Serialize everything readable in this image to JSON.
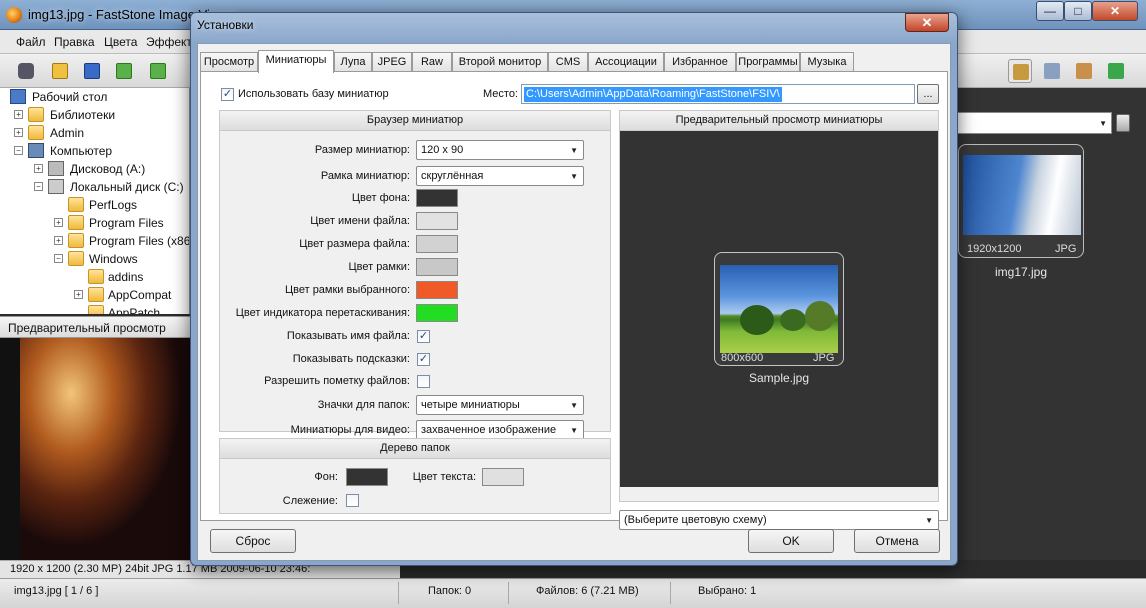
{
  "app": {
    "title": "img13.jpg  -  FastStone Image Viewer",
    "window_controls": [
      "—",
      "□",
      "✕"
    ],
    "menu": [
      "Файл",
      "Правка",
      "Цвета",
      "Эффекты"
    ]
  },
  "tree": {
    "items": [
      {
        "label": "Рабочий стол",
        "icon": "desktop-icon"
      },
      {
        "label": "Библиотеки",
        "icon": "library-icon"
      },
      {
        "label": "Admin",
        "icon": "user-folder-icon"
      },
      {
        "label": "Компьютер",
        "icon": "computer-icon"
      },
      {
        "label": "Дисковод (A:)",
        "icon": "floppy-drive-icon"
      },
      {
        "label": "Локальный диск (C:)",
        "icon": "hard-drive-icon"
      },
      {
        "label": "PerfLogs",
        "icon": "folder-icon"
      },
      {
        "label": "Program Files",
        "icon": "folder-icon"
      },
      {
        "label": "Program Files (x86)",
        "icon": "folder-icon"
      },
      {
        "label": "Windows",
        "icon": "folder-icon"
      },
      {
        "label": "addins",
        "icon": "folder-icon"
      },
      {
        "label": "AppCompat",
        "icon": "folder-icon"
      },
      {
        "label": "AppPatch",
        "icon": "folder-icon"
      }
    ]
  },
  "preview_panel": {
    "title": "Предварительный просмотр"
  },
  "status_bar_top": {
    "info": "1920 x 1200 (2.30 MP)  24bit  JPG   1.17 MB   2009-06-10 23:46:"
  },
  "status_bar_bottom": {
    "file": "img13.jpg [ 1 / 6 ]",
    "folders": "Папок: 0",
    "files": "Файлов: 6 (7.21 MB)",
    "selected": "Выбрано: 1"
  },
  "browser_thumb": {
    "meta_size": "1920x1200",
    "meta_type": "JPG",
    "name": "img17.jpg"
  },
  "dialog": {
    "title": "Установки",
    "close": "✕",
    "tabs": [
      "Просмотр",
      "Миниатюры",
      "Лупа",
      "JPEG",
      "Raw",
      "Второй монитор",
      "CMS",
      "Ассоциации",
      "Избранное",
      "Программы",
      "Музыка"
    ],
    "active_tab": "Миниатюры",
    "use_db_label": "Использовать базу миниатюр",
    "use_db_checked": true,
    "location_label": "Место:",
    "location_value": "C:\\Users\\Admin\\AppData\\Roaming\\FastStone\\FSIV\\",
    "browse_label": "...",
    "browser_group": {
      "title": "Браузер миниатюр",
      "thumb_size_label": "Размер миниатюр:",
      "thumb_size_value": "120 x 90",
      "thumb_frame_label": "Рамка миниатюр:",
      "thumb_frame_value": "скруглённая",
      "bg_color_label": "Цвет фона:",
      "bg_color": "#333333",
      "filename_color_label": "Цвет имени файла:",
      "filename_color": "#e2e2e2",
      "filesize_color_label": "Цвет размера файла:",
      "filesize_color": "#d2d2d2",
      "frame_color_label": "Цвет рамки:",
      "frame_color": "#c8c8c8",
      "selected_frame_color_label": "Цвет рамки выбранного:",
      "selected_frame_color": "#f05a28",
      "drag_indicator_color_label": "Цвет индикатора перетаскивания:",
      "drag_indicator_color": "#22dd22",
      "show_filename_label": "Показывать имя файла:",
      "show_filename": true,
      "show_tooltips_label": "Показывать подсказки:",
      "show_tooltips": true,
      "allow_tagging_label": "Разрешить пометку файлов:",
      "allow_tagging": false,
      "folder_icons_label": "Значки для папок:",
      "folder_icons_value": "четыре миниатюры",
      "video_thumbs_label": "Миниатюры для видео:",
      "video_thumbs_value": "захваченное изображение"
    },
    "tree_group": {
      "title": "Дерево папок",
      "bg_label": "Фон:",
      "bg_color": "#333333",
      "text_color_label": "Цвет текста:",
      "text_color": "#e0e0e0",
      "tracking_label": "Слежение:",
      "tracking": false
    },
    "preview_group": {
      "title": "Предварительный просмотр миниатюры",
      "meta_size": "800x600",
      "meta_type": "JPG",
      "name": "Sample.jpg",
      "color_scheme_placeholder": "(Выберите цветовую схему)"
    },
    "buttons": {
      "reset": "Сброс",
      "ok": "OK",
      "cancel": "Отмена"
    }
  }
}
